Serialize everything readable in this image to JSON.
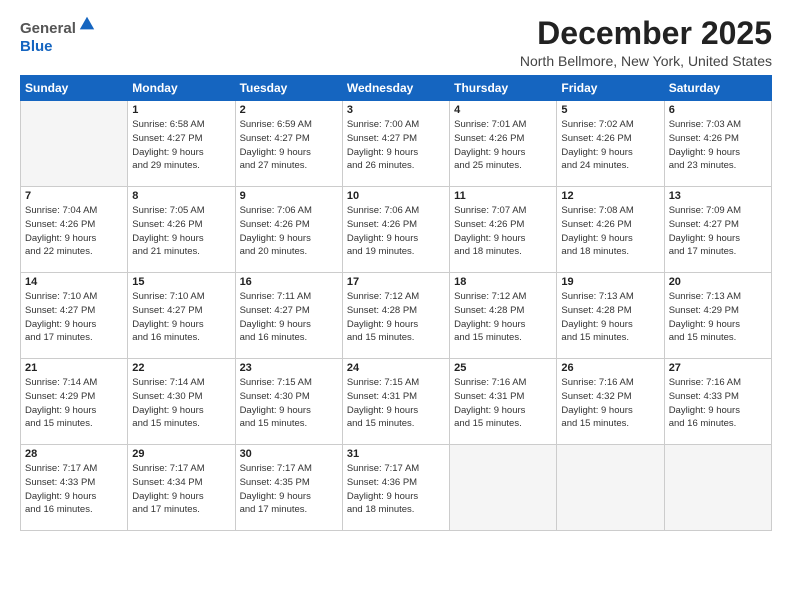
{
  "logo": {
    "general": "General",
    "blue": "Blue"
  },
  "title": "December 2025",
  "location": "North Bellmore, New York, United States",
  "headers": [
    "Sunday",
    "Monday",
    "Tuesday",
    "Wednesday",
    "Thursday",
    "Friday",
    "Saturday"
  ],
  "weeks": [
    [
      {
        "day": "",
        "info": ""
      },
      {
        "day": "1",
        "info": "Sunrise: 6:58 AM\nSunset: 4:27 PM\nDaylight: 9 hours\nand 29 minutes."
      },
      {
        "day": "2",
        "info": "Sunrise: 6:59 AM\nSunset: 4:27 PM\nDaylight: 9 hours\nand 27 minutes."
      },
      {
        "day": "3",
        "info": "Sunrise: 7:00 AM\nSunset: 4:27 PM\nDaylight: 9 hours\nand 26 minutes."
      },
      {
        "day": "4",
        "info": "Sunrise: 7:01 AM\nSunset: 4:26 PM\nDaylight: 9 hours\nand 25 minutes."
      },
      {
        "day": "5",
        "info": "Sunrise: 7:02 AM\nSunset: 4:26 PM\nDaylight: 9 hours\nand 24 minutes."
      },
      {
        "day": "6",
        "info": "Sunrise: 7:03 AM\nSunset: 4:26 PM\nDaylight: 9 hours\nand 23 minutes."
      }
    ],
    [
      {
        "day": "7",
        "info": "Sunrise: 7:04 AM\nSunset: 4:26 PM\nDaylight: 9 hours\nand 22 minutes."
      },
      {
        "day": "8",
        "info": "Sunrise: 7:05 AM\nSunset: 4:26 PM\nDaylight: 9 hours\nand 21 minutes."
      },
      {
        "day": "9",
        "info": "Sunrise: 7:06 AM\nSunset: 4:26 PM\nDaylight: 9 hours\nand 20 minutes."
      },
      {
        "day": "10",
        "info": "Sunrise: 7:06 AM\nSunset: 4:26 PM\nDaylight: 9 hours\nand 19 minutes."
      },
      {
        "day": "11",
        "info": "Sunrise: 7:07 AM\nSunset: 4:26 PM\nDaylight: 9 hours\nand 18 minutes."
      },
      {
        "day": "12",
        "info": "Sunrise: 7:08 AM\nSunset: 4:26 PM\nDaylight: 9 hours\nand 18 minutes."
      },
      {
        "day": "13",
        "info": "Sunrise: 7:09 AM\nSunset: 4:27 PM\nDaylight: 9 hours\nand 17 minutes."
      }
    ],
    [
      {
        "day": "14",
        "info": "Sunrise: 7:10 AM\nSunset: 4:27 PM\nDaylight: 9 hours\nand 17 minutes."
      },
      {
        "day": "15",
        "info": "Sunrise: 7:10 AM\nSunset: 4:27 PM\nDaylight: 9 hours\nand 16 minutes."
      },
      {
        "day": "16",
        "info": "Sunrise: 7:11 AM\nSunset: 4:27 PM\nDaylight: 9 hours\nand 16 minutes."
      },
      {
        "day": "17",
        "info": "Sunrise: 7:12 AM\nSunset: 4:28 PM\nDaylight: 9 hours\nand 15 minutes."
      },
      {
        "day": "18",
        "info": "Sunrise: 7:12 AM\nSunset: 4:28 PM\nDaylight: 9 hours\nand 15 minutes."
      },
      {
        "day": "19",
        "info": "Sunrise: 7:13 AM\nSunset: 4:28 PM\nDaylight: 9 hours\nand 15 minutes."
      },
      {
        "day": "20",
        "info": "Sunrise: 7:13 AM\nSunset: 4:29 PM\nDaylight: 9 hours\nand 15 minutes."
      }
    ],
    [
      {
        "day": "21",
        "info": "Sunrise: 7:14 AM\nSunset: 4:29 PM\nDaylight: 9 hours\nand 15 minutes."
      },
      {
        "day": "22",
        "info": "Sunrise: 7:14 AM\nSunset: 4:30 PM\nDaylight: 9 hours\nand 15 minutes."
      },
      {
        "day": "23",
        "info": "Sunrise: 7:15 AM\nSunset: 4:30 PM\nDaylight: 9 hours\nand 15 minutes."
      },
      {
        "day": "24",
        "info": "Sunrise: 7:15 AM\nSunset: 4:31 PM\nDaylight: 9 hours\nand 15 minutes."
      },
      {
        "day": "25",
        "info": "Sunrise: 7:16 AM\nSunset: 4:31 PM\nDaylight: 9 hours\nand 15 minutes."
      },
      {
        "day": "26",
        "info": "Sunrise: 7:16 AM\nSunset: 4:32 PM\nDaylight: 9 hours\nand 15 minutes."
      },
      {
        "day": "27",
        "info": "Sunrise: 7:16 AM\nSunset: 4:33 PM\nDaylight: 9 hours\nand 16 minutes."
      }
    ],
    [
      {
        "day": "28",
        "info": "Sunrise: 7:17 AM\nSunset: 4:33 PM\nDaylight: 9 hours\nand 16 minutes."
      },
      {
        "day": "29",
        "info": "Sunrise: 7:17 AM\nSunset: 4:34 PM\nDaylight: 9 hours\nand 17 minutes."
      },
      {
        "day": "30",
        "info": "Sunrise: 7:17 AM\nSunset: 4:35 PM\nDaylight: 9 hours\nand 17 minutes."
      },
      {
        "day": "31",
        "info": "Sunrise: 7:17 AM\nSunset: 4:36 PM\nDaylight: 9 hours\nand 18 minutes."
      },
      {
        "day": "",
        "info": ""
      },
      {
        "day": "",
        "info": ""
      },
      {
        "day": "",
        "info": ""
      }
    ]
  ]
}
